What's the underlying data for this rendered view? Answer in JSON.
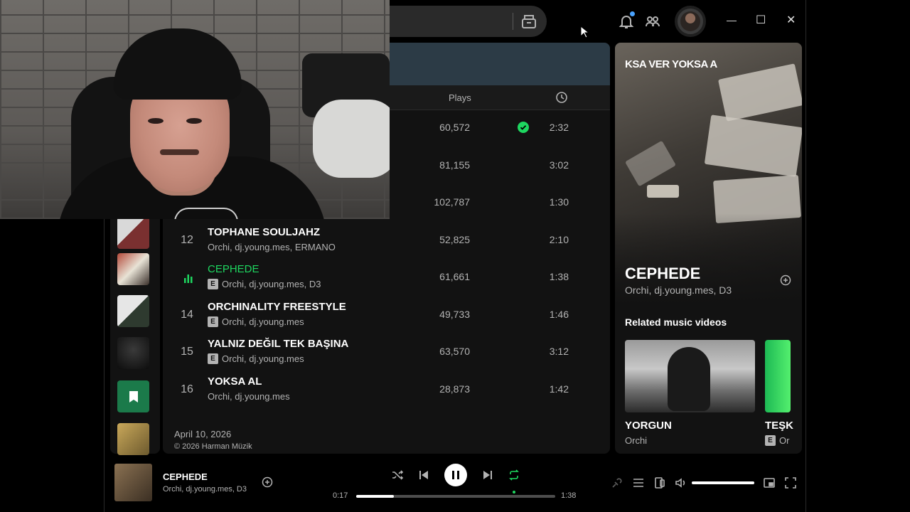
{
  "window": {
    "controls": {
      "minimize": "—",
      "maximize": "☐",
      "close": "✕"
    }
  },
  "table": {
    "header_plays": "Plays",
    "rows": [
      {
        "number": "",
        "title": "",
        "artist": "",
        "explicit": false,
        "plays": "60,572",
        "saved": true,
        "duration": "2:32"
      },
      {
        "number": "",
        "title": "",
        "artist": "",
        "explicit": false,
        "plays": "81,155",
        "saved": false,
        "duration": "3:02"
      },
      {
        "number": "",
        "title": "",
        "artist": "",
        "explicit": false,
        "plays": "102,787",
        "saved": false,
        "duration": "1:30"
      },
      {
        "number": "12",
        "title": "TOPHANE SOULJAHZ",
        "artist": "Orchi, dj.young.mes, ERMANO",
        "explicit": false,
        "plays": "52,825",
        "saved": false,
        "duration": "2:10"
      },
      {
        "number": "",
        "title": "CEPHEDE",
        "artist": "Orchi, dj.young.mes, D3",
        "explicit": true,
        "plays": "61,661",
        "saved": false,
        "duration": "1:38",
        "playing": true
      },
      {
        "number": "14",
        "title": "ORCHINALITY FREESTYLE",
        "artist": "Orchi, dj.young.mes",
        "explicit": true,
        "plays": "49,733",
        "saved": false,
        "duration": "1:46"
      },
      {
        "number": "15",
        "title": "YALNIZ DEĞIL TEK BAŞINA",
        "artist": "Orchi, dj.young.mes",
        "explicit": true,
        "plays": "63,570",
        "saved": false,
        "duration": "3:12"
      },
      {
        "number": "16",
        "title": "YOKSA AL",
        "artist": "Orchi, dj.young.mes",
        "explicit": false,
        "plays": "28,873",
        "saved": false,
        "duration": "1:42"
      }
    ],
    "release_date": "April 10, 2026",
    "copyright": "© 2026 Harman Müzik"
  },
  "now_playing_panel": {
    "album_title": "KSA VER YOKSA AL",
    "title": "CEPHEDE",
    "artist": "Orchi, dj.young.mes, D3",
    "related_heading": "Related music videos",
    "videos": [
      {
        "title": "YORGUN",
        "artist": "Orchi",
        "explicit": false
      },
      {
        "title": "TEŞK",
        "artist": "Or",
        "explicit": true
      }
    ]
  },
  "player": {
    "title": "CEPHEDE",
    "artist": "Orchi, dj.young.mes, D3",
    "elapsed": "0:17",
    "total": "1:38",
    "progress_fraction": 0.19,
    "volume_fraction": 1.0,
    "repeat_active": true
  },
  "colors": {
    "accent": "#1ed760",
    "background": "#121212",
    "header": "#2c3b46"
  },
  "icons": [
    "search-icon",
    "browse-icon",
    "bell-icon",
    "friends-icon",
    "clock-icon",
    "check-circle-icon",
    "equalizer-icon",
    "plus-circle-icon",
    "shuffle-icon",
    "previous-icon",
    "pause-icon",
    "next-icon",
    "repeat-icon",
    "lyrics-icon",
    "queue-icon",
    "connect-device-icon",
    "volume-icon",
    "miniplayer-icon",
    "fullscreen-icon"
  ]
}
